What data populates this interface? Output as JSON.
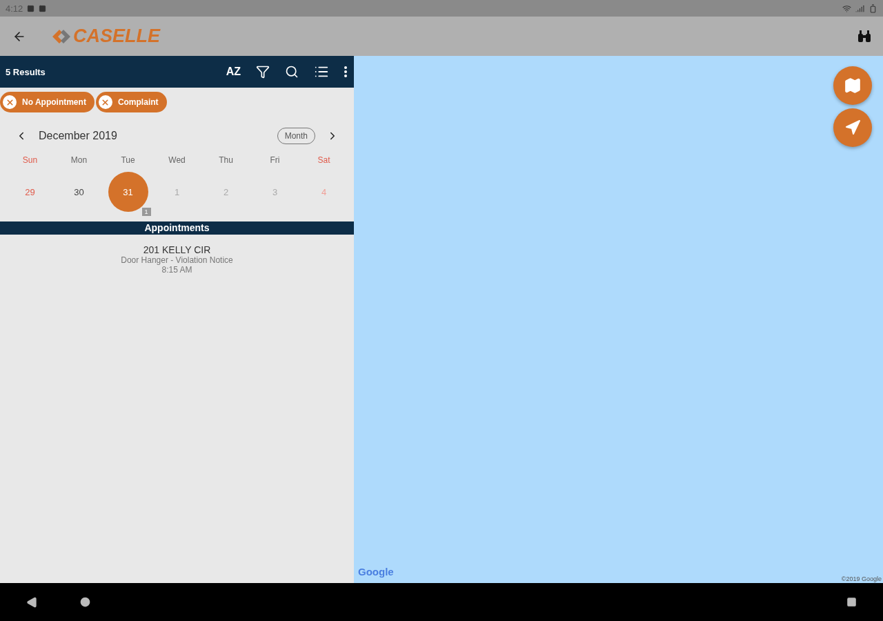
{
  "status_bar": {
    "time": "4:12"
  },
  "app_bar": {
    "logo": "CASELLE"
  },
  "toolbar": {
    "title": "5 Results",
    "sort_label": "AZ"
  },
  "chips": [
    {
      "label": "No Appointment"
    },
    {
      "label": "Complaint"
    }
  ],
  "calendar": {
    "month": "December 2019",
    "view": "Month",
    "weekdays": [
      {
        "label": "Sun",
        "weekend": true
      },
      {
        "label": "Mon",
        "weekend": false
      },
      {
        "label": "Tue",
        "weekend": false
      },
      {
        "label": "Wed",
        "weekend": false
      },
      {
        "label": "Thu",
        "weekend": false
      },
      {
        "label": "Fri",
        "weekend": false
      },
      {
        "label": "Sat",
        "weekend": true
      }
    ],
    "days": [
      {
        "label": "29",
        "weekend": true,
        "other_month": false,
        "selected": false
      },
      {
        "label": "30",
        "weekend": false,
        "other_month": false,
        "selected": false
      },
      {
        "label": "31",
        "weekend": false,
        "other_month": false,
        "selected": true,
        "count": "1"
      },
      {
        "label": "1",
        "weekend": false,
        "other_month": true,
        "selected": false
      },
      {
        "label": "2",
        "weekend": false,
        "other_month": true,
        "selected": false
      },
      {
        "label": "3",
        "weekend": false,
        "other_month": true,
        "selected": false
      },
      {
        "label": "4",
        "weekend": true,
        "other_month": true,
        "selected": false
      }
    ]
  },
  "appointments": {
    "title": "Appointments",
    "items": [
      {
        "address": "201 KELLY CIR",
        "type": "Door Hanger - Violation Notice",
        "time": "8:15 AM"
      }
    ]
  },
  "map": {
    "logo": "Google",
    "copyright": "©2019 Google"
  }
}
